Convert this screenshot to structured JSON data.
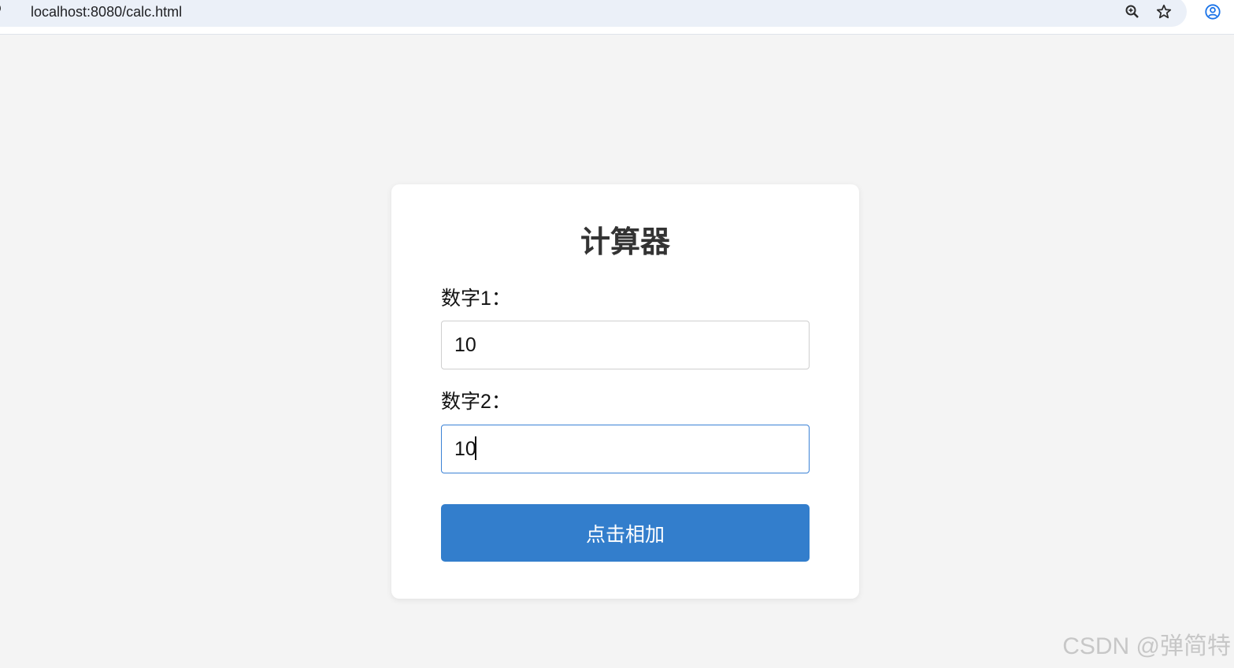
{
  "browser": {
    "url": "localhost:8080/calc.html",
    "icons": [
      "info-icon",
      "zoom-icon",
      "star-icon",
      "profile-icon"
    ]
  },
  "calculator": {
    "title": "计算器",
    "number1_label": "数字1：",
    "number1_value": "10",
    "number2_label": "数字2：",
    "number2_value": "10",
    "add_button_label": "点击相加"
  },
  "watermark": "CSDN @弹简特",
  "colors": {
    "page_bg": "#f4f4f4",
    "card_bg": "#ffffff",
    "button_bg": "#337ecc",
    "focus_border": "#3b82d6"
  }
}
